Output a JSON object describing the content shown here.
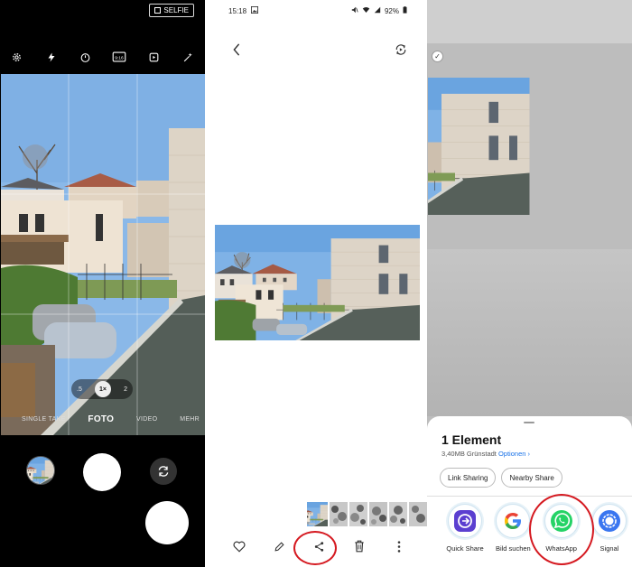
{
  "camera": {
    "selfie_label": "SELFIE",
    "zoom_options": [
      ".5",
      "1×",
      "2"
    ],
    "modes": [
      "SINGLE TAKE",
      "FOTO",
      "VIDEO",
      "MEHR"
    ],
    "active_mode": "FOTO",
    "aspect_label": "9:16"
  },
  "gallery": {
    "status_time": "15:18",
    "status_battery": "92%"
  },
  "share": {
    "title": "1 Element",
    "meta": "3,40MB  Grünstadt",
    "options_link": "Optionen ›",
    "chips": [
      "Link Sharing",
      "Nearby Share"
    ],
    "apps": [
      "Quick Share",
      "Bild suchen",
      "WhatsApp",
      "Signal"
    ]
  },
  "colors": {
    "annotation_red": "#d51920",
    "whatsapp_green": "#25d366",
    "signal_blue": "#3a76f0",
    "link_blue": "#1a73e8"
  }
}
